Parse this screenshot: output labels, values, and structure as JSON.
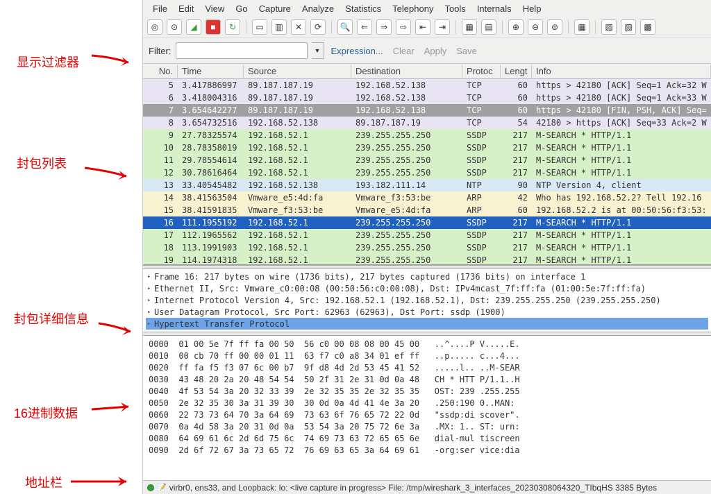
{
  "annotations": {
    "filter": "显示过滤器",
    "list": "封包列表",
    "detail": "封包详细信息",
    "hex": "16进制数据",
    "status": "地址栏"
  },
  "menu": [
    "File",
    "Edit",
    "View",
    "Go",
    "Capture",
    "Analyze",
    "Statistics",
    "Telephony",
    "Tools",
    "Internals",
    "Help"
  ],
  "filter": {
    "label": "Filter:",
    "value": "",
    "expression": "Expression...",
    "clear": "Clear",
    "apply": "Apply",
    "save": "Save"
  },
  "columns": [
    "No.",
    "Time",
    "Source",
    "Destination",
    "Protoc",
    "Lengt",
    "Info"
  ],
  "packets": [
    {
      "no": 5,
      "time": "3.417886997",
      "src": "89.187.187.19",
      "dst": "192.168.52.138",
      "prot": "TCP",
      "len": 60,
      "info": "https > 42180 [ACK] Seq=1 Ack=32 W",
      "bg": "#e8e4f3"
    },
    {
      "no": 6,
      "time": "3.418004316",
      "src": "89.187.187.19",
      "dst": "192.168.52.138",
      "prot": "TCP",
      "len": 60,
      "info": "https > 42180 [ACK] Seq=1 Ack=33 W",
      "bg": "#e8e4f3"
    },
    {
      "no": 7,
      "time": "3.654642277",
      "src": "89.187.187.19",
      "dst": "192.168.52.138",
      "prot": "TCP",
      "len": 60,
      "info": "https > 42180 [FIN, PSH, ACK] Seq=",
      "bg": "#a0a0a0",
      "fg": "#fff"
    },
    {
      "no": 8,
      "time": "3.654732516",
      "src": "192.168.52.138",
      "dst": "89.187.187.19",
      "prot": "TCP",
      "len": 54,
      "info": "42180 > https [ACK] Seq=33 Ack=2 W",
      "bg": "#e8e4f3"
    },
    {
      "no": 9,
      "time": "27.78325574",
      "src": "192.168.52.1",
      "dst": "239.255.255.250",
      "prot": "SSDP",
      "len": 217,
      "info": "M-SEARCH * HTTP/1.1",
      "bg": "#d6f0c8"
    },
    {
      "no": 10,
      "time": "28.78358019",
      "src": "192.168.52.1",
      "dst": "239.255.255.250",
      "prot": "SSDP",
      "len": 217,
      "info": "M-SEARCH * HTTP/1.1",
      "bg": "#d6f0c8"
    },
    {
      "no": 11,
      "time": "29.78554614",
      "src": "192.168.52.1",
      "dst": "239.255.255.250",
      "prot": "SSDP",
      "len": 217,
      "info": "M-SEARCH * HTTP/1.1",
      "bg": "#d6f0c8"
    },
    {
      "no": 12,
      "time": "30.78616464",
      "src": "192.168.52.1",
      "dst": "239.255.255.250",
      "prot": "SSDP",
      "len": 217,
      "info": "M-SEARCH * HTTP/1.1",
      "bg": "#d6f0c8"
    },
    {
      "no": 13,
      "time": "33.40545482",
      "src": "192.168.52.138",
      "dst": "193.182.111.14",
      "prot": "NTP",
      "len": 90,
      "info": "NTP Version 4, client",
      "bg": "#d8e8f5"
    },
    {
      "no": 14,
      "time": "38.41563504",
      "src": "Vmware_e5:4d:fa",
      "dst": "Vmware_f3:53:be",
      "prot": "ARP",
      "len": 42,
      "info": "Who has 192.168.52.2?  Tell 192.16",
      "bg": "#f8f2d0"
    },
    {
      "no": 15,
      "time": "38.41591835",
      "src": "Vmware_f3:53:be",
      "dst": "Vmware_e5:4d:fa",
      "prot": "ARP",
      "len": 60,
      "info": "192.168.52.2 is at 00:50:56:f3:53:",
      "bg": "#f8f2d0"
    },
    {
      "no": 16,
      "time": "111.1955192",
      "src": "192.168.52.1",
      "dst": "239.255.255.250",
      "prot": "SSDP",
      "len": 217,
      "info": "M-SEARCH * HTTP/1.1",
      "bg": "#2060c0",
      "fg": "#fff"
    },
    {
      "no": 17,
      "time": "112.1965562",
      "src": "192.168.52.1",
      "dst": "239.255.255.250",
      "prot": "SSDP",
      "len": 217,
      "info": "M-SEARCH * HTTP/1.1",
      "bg": "#d6f0c8"
    },
    {
      "no": 18,
      "time": "113.1991903",
      "src": "192.168.52.1",
      "dst": "239.255.255.250",
      "prot": "SSDP",
      "len": 217,
      "info": "M-SEARCH * HTTP/1.1",
      "bg": "#d6f0c8"
    },
    {
      "no": 19,
      "time": "114.1974318",
      "src": "192.168.52.1",
      "dst": "239.255.255.250",
      "prot": "SSDP",
      "len": 217,
      "info": "M-SEARCH * HTTP/1.1",
      "bg": "#d6f0c8"
    }
  ],
  "details": [
    {
      "text": "Frame 16: 217 bytes on wire (1736 bits), 217 bytes captured (1736 bits) on interface 1",
      "sel": false
    },
    {
      "text": "Ethernet II, Src: Vmware_c0:00:08 (00:50:56:c0:00:08), Dst: IPv4mcast_7f:ff:fa (01:00:5e:7f:ff:fa)",
      "sel": false
    },
    {
      "text": "Internet Protocol Version 4, Src: 192.168.52.1 (192.168.52.1), Dst: 239.255.255.250 (239.255.255.250)",
      "sel": false
    },
    {
      "text": "User Datagram Protocol, Src Port: 62963 (62963), Dst Port: ssdp (1900)",
      "sel": false
    },
    {
      "text": "Hypertext Transfer Protocol",
      "sel": true
    }
  ],
  "hex": [
    "0000  01 00 5e 7f ff fa 00 50  56 c0 00 08 08 00 45 00   ..^....P V.....E.",
    "0010  00 cb 70 ff 00 00 01 11  63 f7 c0 a8 34 01 ef ff   ..p..... c...4...",
    "0020  ff fa f5 f3 07 6c 00 b7  9f d8 4d 2d 53 45 41 52   .....l.. ..M-SEAR",
    "0030  43 48 20 2a 20 48 54 54  50 2f 31 2e 31 0d 0a 48   CH * HTT P/1.1..H",
    "0040  4f 53 54 3a 20 32 33 39  2e 32 35 35 2e 32 35 35   OST: 239 .255.255",
    "0050  2e 32 35 30 3a 31 39 30  30 0d 0a 4d 41 4e 3a 20   .250:190 0..MAN: ",
    "0060  22 73 73 64 70 3a 64 69  73 63 6f 76 65 72 22 0d   \"ssdp:di scover\".",
    "0070  0a 4d 58 3a 20 31 0d 0a  53 54 3a 20 75 72 6e 3a   .MX: 1.. ST: urn:",
    "0080  64 69 61 6c 2d 6d 75 6c  74 69 73 63 72 65 65 6e   dial-mul tiscreen",
    "0090  2d 6f 72 67 3a 73 65 72  76 69 63 65 3a 64 69 61   -org:ser vice:dia"
  ],
  "status": "virbr0, ens33, and Loopback: lo: <live capture in progress> File: /tmp/wireshark_3_interfaces_20230308064320_TIbqHS 3385 Bytes"
}
